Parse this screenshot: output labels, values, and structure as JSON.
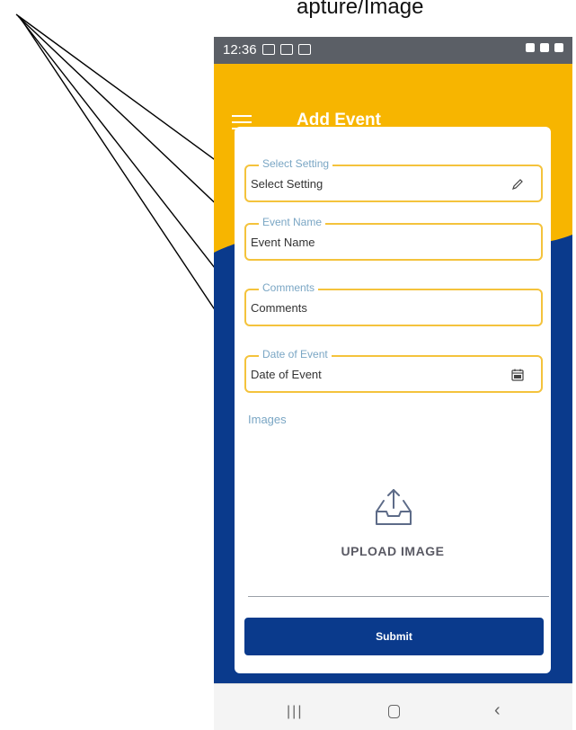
{
  "caption": "apture/Image",
  "status_bar": {
    "time": "12:36"
  },
  "app_bar": {
    "title": "Add Event"
  },
  "form": {
    "fields": [
      {
        "label": "Select Setting",
        "value": "Select Setting",
        "icon": "pencil-icon"
      },
      {
        "label": "Event Name",
        "value": "Event Name"
      },
      {
        "label": "Comments",
        "value": "Comments"
      },
      {
        "label": "Date of Event",
        "value": "Date of Event",
        "icon": "calendar-icon"
      }
    ],
    "images_label": "Images",
    "upload_label": "UPLOAD IMAGE",
    "submit_label": "Submit"
  },
  "colors": {
    "primary": "#0a3a8c",
    "accent": "#f7b500",
    "field_border": "#f4c33c",
    "label": "#7aa6c4"
  }
}
